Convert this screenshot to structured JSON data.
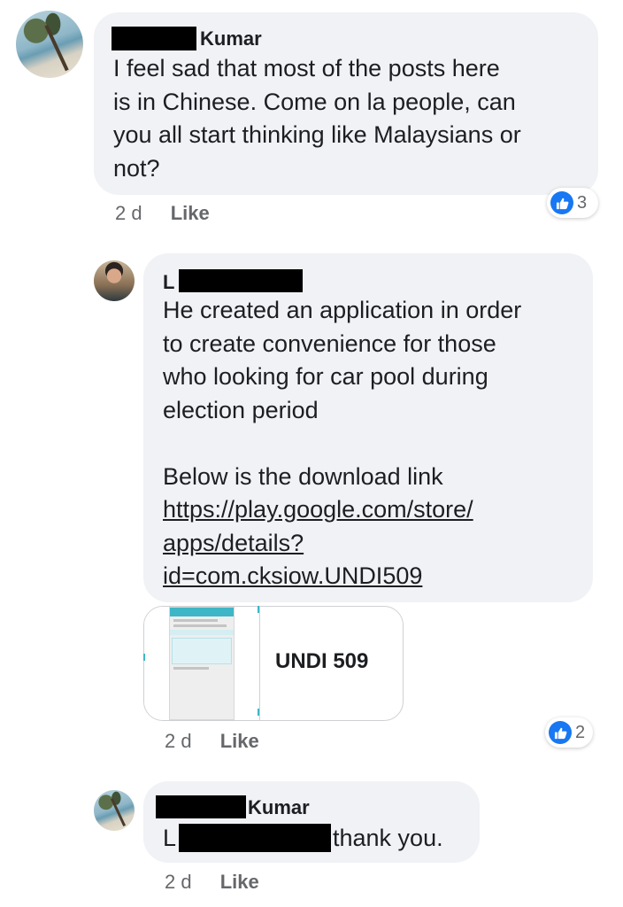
{
  "comments": [
    {
      "author_suffix": "Kumar",
      "text": "I feel sad that most of the posts here is in Chinese. Come on la people, can you all start thinking like Malaysians or not?",
      "lines": [
        "I feel sad that most of the posts here",
        "is in Chinese. Come on la people, can",
        "you all start thinking like Malaysians or",
        "not?"
      ],
      "time": "2 d",
      "like_label": "Like",
      "reaction_icon": "thumbs-up-icon",
      "reaction_count": "3"
    },
    {
      "author_prefix": "L",
      "lines": [
        "He created an application in order",
        "to create convenience for those",
        "who looking for car pool during",
        "election period"
      ],
      "download_line": "Below is the download link",
      "link_lines": [
        "https://play.google.com/store/",
        "apps/details?",
        "id=com.cksiow.UNDI509"
      ],
      "card_title": "UNDI 509",
      "time": "2 d",
      "like_label": "Like",
      "reaction_icon": "thumbs-up-icon",
      "reaction_count": "2"
    },
    {
      "author_suffix": "Kumar",
      "text_prefix": "L",
      "text_suffix": "thank you.",
      "time": "2 d",
      "like_label": "Like"
    }
  ],
  "colors": {
    "bubble": "#f0f2f5",
    "meta_text": "#65676b",
    "like_blue": "#1877f2"
  }
}
